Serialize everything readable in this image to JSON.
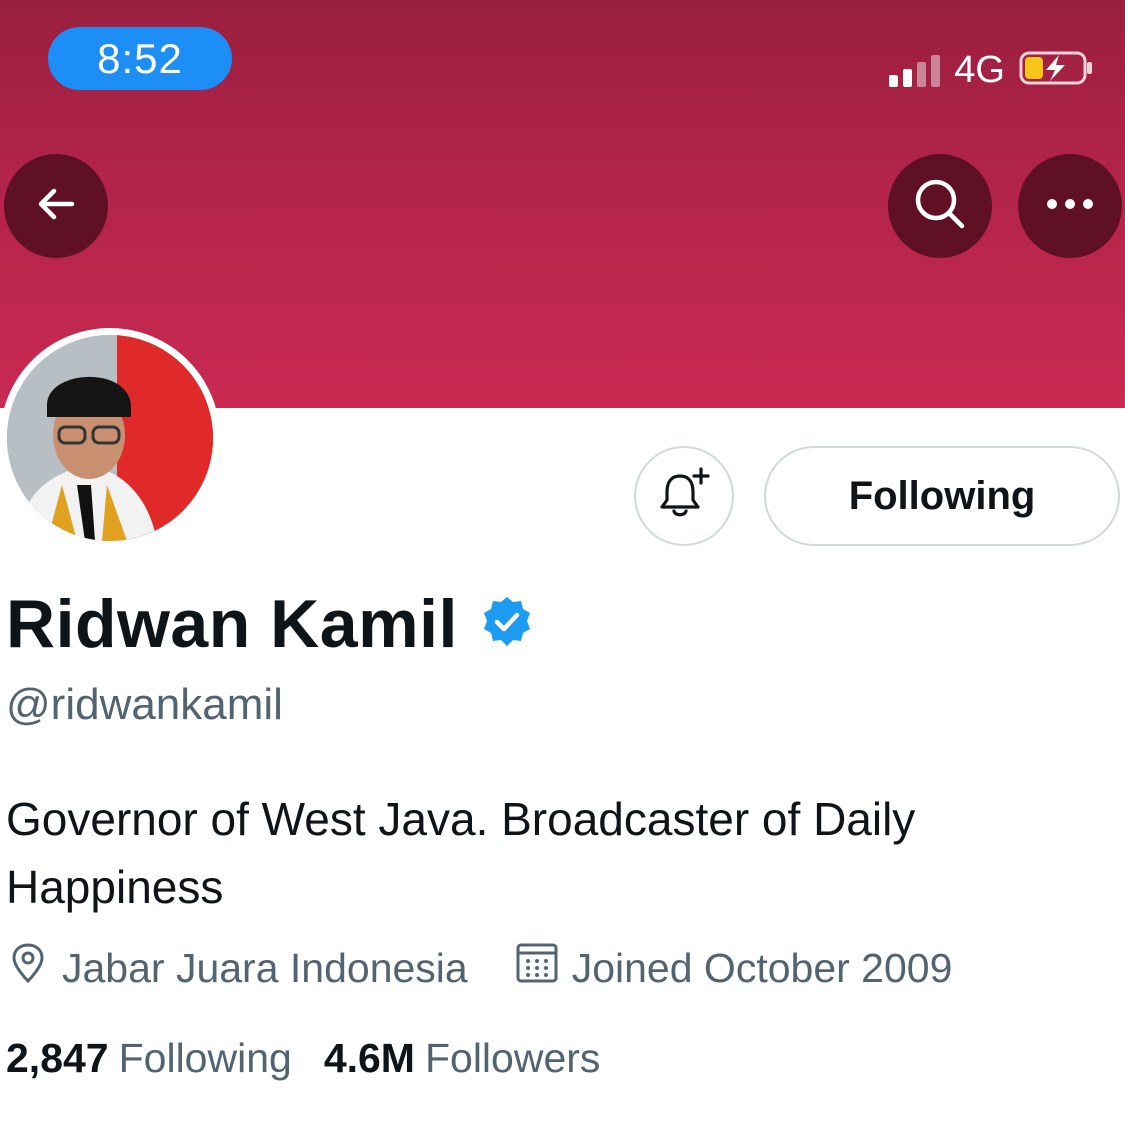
{
  "status_bar": {
    "time": "8:52",
    "network": "4G",
    "signal_bars": 4,
    "signal_bars_active": 2,
    "battery_icon": "battery-charging-low-icon",
    "battery_color": "#f5c518"
  },
  "header": {
    "back_icon": "arrow-left-icon",
    "search_icon": "search-icon",
    "more_icon": "more-horizontal-icon",
    "banner_color": "#c02a50"
  },
  "profile": {
    "avatar_alt": "profile photo",
    "name": "Ridwan Kamil",
    "verified_icon": "verified-badge-icon",
    "verified_color": "#1d9bf0",
    "handle": "@ridwankamil",
    "bio": "Governor of West Java. Broadcaster of Daily Happiness",
    "location_icon": "location-pin-icon",
    "location": "Jabar Juara Indonesia",
    "joined_icon": "calendar-icon",
    "joined": "Joined October 2009"
  },
  "actions": {
    "notify_icon": "bell-plus-icon",
    "follow_label": "Following"
  },
  "stats": {
    "following_count": "2,847",
    "following_label": "Following",
    "followers_count": "4.6M",
    "followers_label": "Followers"
  }
}
